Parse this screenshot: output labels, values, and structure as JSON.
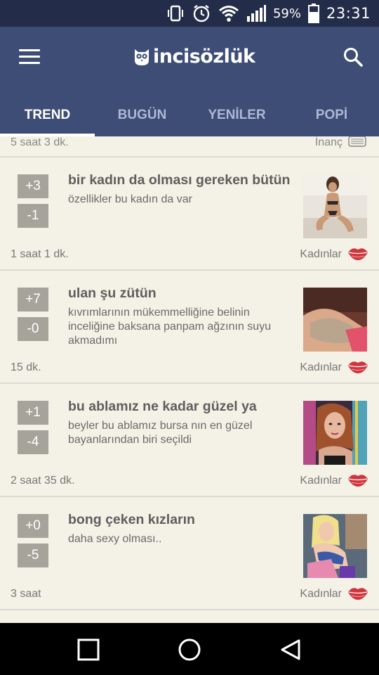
{
  "status_bar": {
    "battery_percent": "59%",
    "clock": "23:31"
  },
  "app": {
    "logo_text": "incisözlük",
    "menu_icon": "hamburger-menu-icon",
    "search_icon": "search-icon"
  },
  "tabs": [
    {
      "label": "TREND",
      "active": true
    },
    {
      "label": "BUGÜN",
      "active": false
    },
    {
      "label": "YENİLER",
      "active": false
    },
    {
      "label": "POPİ",
      "active": false
    }
  ],
  "partial_entry": {
    "time": "5 saat 3 dk.",
    "author": "İnanç"
  },
  "entries": [
    {
      "up": "+3",
      "down": "-1",
      "title": "bir kadın da olması gereken bütün",
      "body": "özellikler bu kadın da var",
      "time": "1 saat 1 dk.",
      "category": "Kadınlar"
    },
    {
      "up": "+7",
      "down": "-0",
      "title": "ulan şu zütün",
      "body": "kıvrımlarının mükemmelliğine belinin inceliğine baksana panpam ağzının suyu akmadımı",
      "time": "15 dk.",
      "category": "Kadınlar"
    },
    {
      "up": "+1",
      "down": "-4",
      "title": "bu ablamız ne kadar güzel ya",
      "body": "beyler bu ablamız bursa nın en güzel bayanlarından biri seçildi",
      "time": "2 saat 35 dk.",
      "category": "Kadınlar"
    },
    {
      "up": "+0",
      "down": "-5",
      "title": "bong çeken kızların",
      "body": "daha sexy olması..",
      "time": "3 saat",
      "category": "Kadınlar"
    }
  ],
  "colors": {
    "status_bar": "#232c48",
    "app_bar": "#3d4d76",
    "background": "#f4f1e6",
    "vote_button": "#a5a39a",
    "category_icon": "#d0343c"
  }
}
